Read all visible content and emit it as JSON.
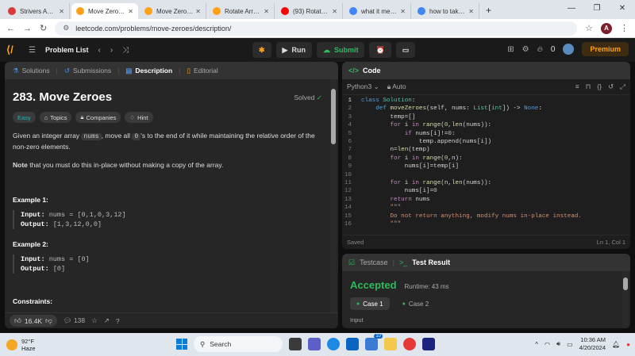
{
  "browser": {
    "tabs": [
      {
        "label": "Strivers A2Z DSA",
        "icon": "striver-icon",
        "color": "#d93a3a",
        "active": false
      },
      {
        "label": "Move Zeroes - L",
        "icon": "leetcode-icon",
        "color": "#ffa116",
        "active": true
      },
      {
        "label": "Move Zeroes - L",
        "icon": "leetcode-icon",
        "color": "#ffa116",
        "active": false
      },
      {
        "label": "Rotate Array - L",
        "icon": "leetcode-icon",
        "color": "#ffa116",
        "active": false
      },
      {
        "label": "(93) Rotate Arra",
        "icon": "youtube-icon",
        "color": "#ff0000",
        "active": false
      },
      {
        "label": "what it mean in",
        "icon": "google-icon",
        "color": "#4285f4",
        "active": false
      },
      {
        "label": "how to take scr",
        "icon": "google-icon",
        "color": "#4285f4",
        "active": false
      }
    ],
    "url": "leetcode.com/problems/move-zeroes/description/",
    "profile_initial": "A"
  },
  "lc_header": {
    "problem_list": "Problem List",
    "run": "Run",
    "submit": "Submit",
    "points": "0",
    "premium": "Premium"
  },
  "left_tabs": {
    "solutions": "Solutions",
    "submissions": "Submissions",
    "description": "Description",
    "editorial": "Editorial"
  },
  "problem": {
    "title": "283. Move Zeroes",
    "solved": "Solved",
    "tags": {
      "easy": "Easy",
      "topics": "Topics",
      "companies": "Companies",
      "hint": "Hint"
    },
    "desc_a": "Given an integer array ",
    "desc_code1": "nums",
    "desc_b": ", move all ",
    "desc_code2": "0",
    "desc_c": "'s to the end of it while maintaining the relative order of the non-zero elements.",
    "note_bold": "Note",
    "note_rest": " that you must do this in-place without making a copy of the array.",
    "ex1_title": "Example 1:",
    "ex1_input_label": "Input:",
    "ex1_input": " nums = [0,1,0,3,12]",
    "ex1_output_label": "Output:",
    "ex1_output": " [1,3,12,0,0]",
    "ex2_title": "Example 2:",
    "ex2_input_label": "Input:",
    "ex2_input": " nums = [0]",
    "ex2_output_label": "Output:",
    "ex2_output": " [0]",
    "constraints": "Constraints:"
  },
  "left_footer": {
    "likes": "16.4K",
    "comments": "138"
  },
  "editor": {
    "header": "Code",
    "language": "Python3",
    "mode": "Auto",
    "status": "Saved",
    "cursor": "Ln 1, Col 1"
  },
  "result": {
    "testcase_tab": "Testcase",
    "result_tab": "Test Result",
    "verdict": "Accepted",
    "runtime": "Runtime: 43 ms",
    "case1": "Case 1",
    "case2": "Case 2",
    "input_label": "Input"
  },
  "taskbar": {
    "temp": "92°F",
    "weather": "Haze",
    "search": "Search",
    "time": "10:36 AM",
    "date": "4/20/2024",
    "badge": "10"
  }
}
